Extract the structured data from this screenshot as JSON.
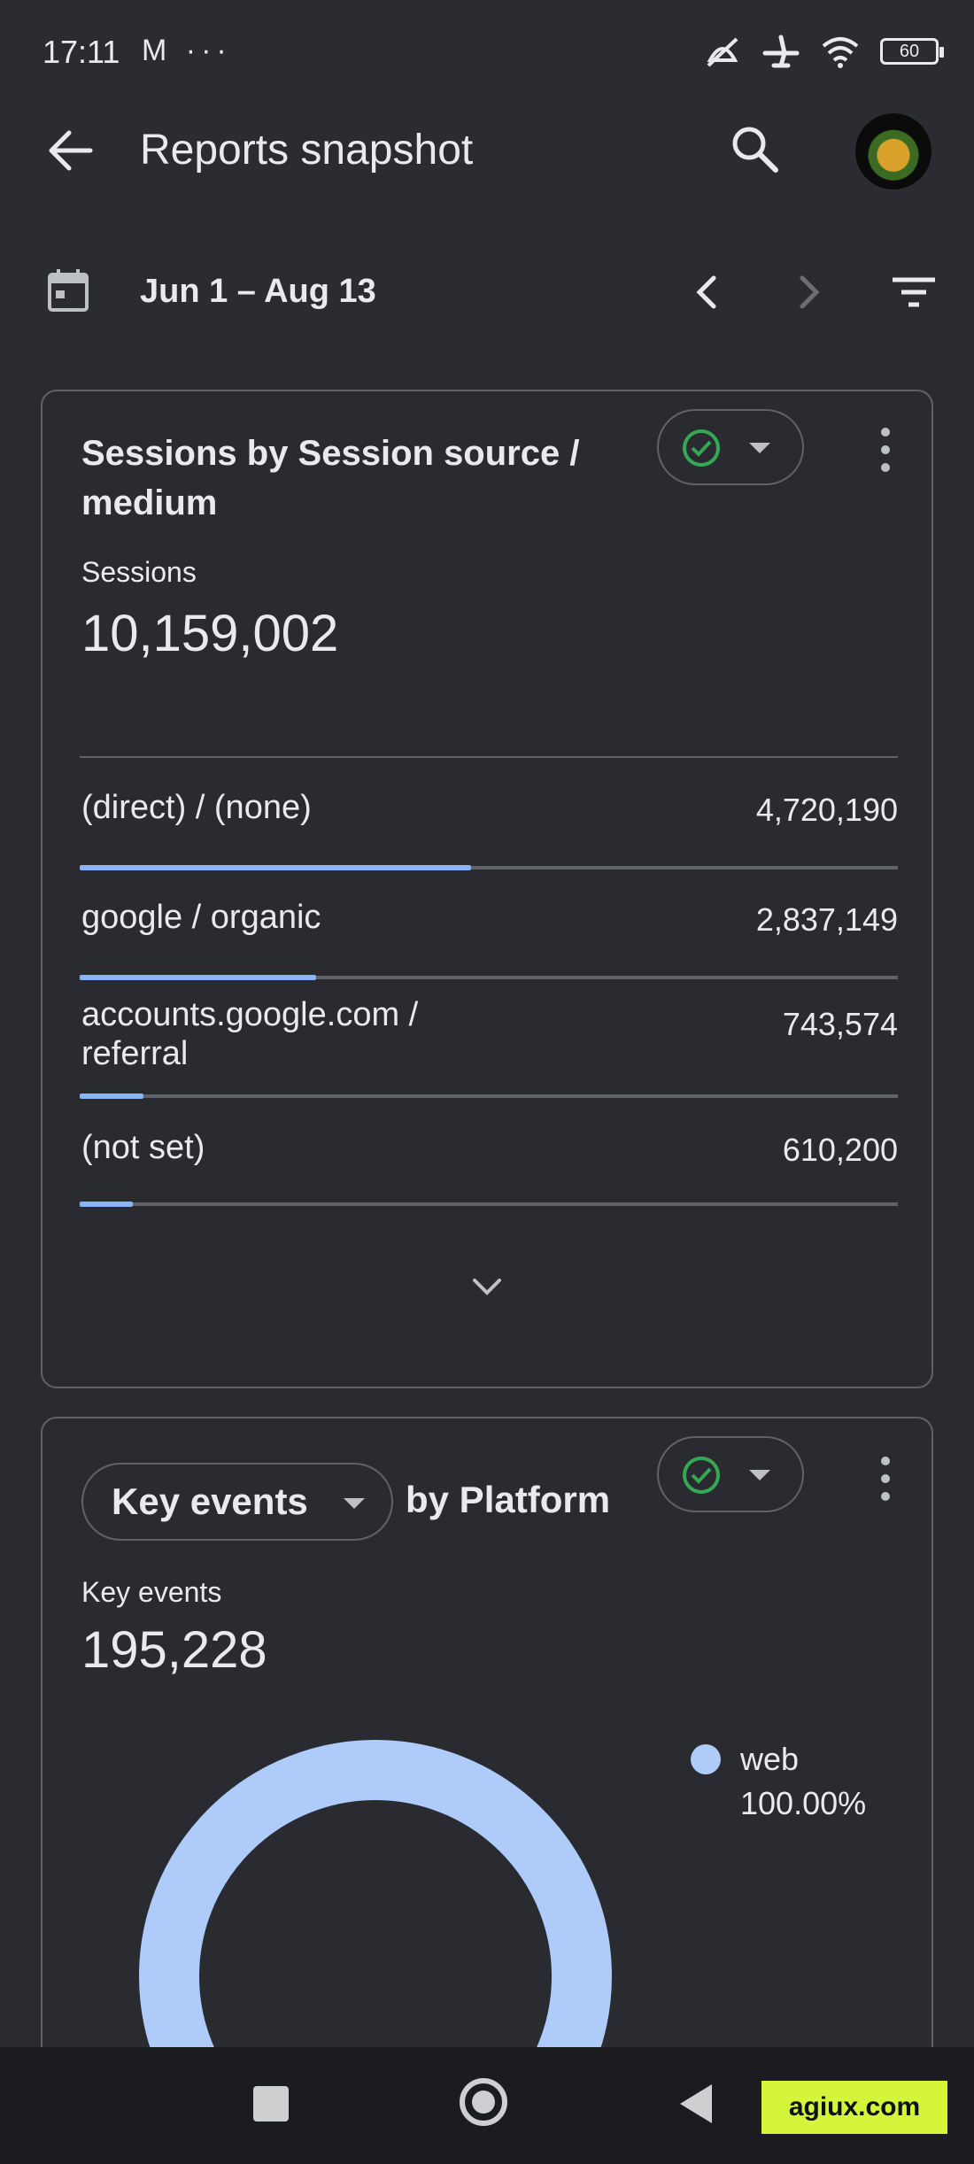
{
  "status_bar": {
    "time": "17:11",
    "left_icons": "M ···",
    "battery": "60"
  },
  "app_bar": {
    "title": "Reports snapshot"
  },
  "date_bar": {
    "range": "Jun 1 – Aug 13"
  },
  "card_sessions": {
    "title": "Sessions by Session source / medium",
    "metric_label": "Sessions",
    "metric_value": "10,159,002",
    "rows": [
      {
        "label": "(direct) / (none)",
        "value": "4,720,190",
        "share": 0.478
      },
      {
        "label": "google / organic",
        "value": "2,837,149",
        "share": 0.289
      },
      {
        "label": "accounts.google.com / referral",
        "value": "743,574",
        "share": 0.078
      },
      {
        "label": "(not set)",
        "value": "610,200",
        "share": 0.065
      }
    ]
  },
  "card_key_events": {
    "metric_dropdown": "Key events",
    "title_suffix": "by Platform",
    "metric_label": "Key events",
    "metric_value": "195,228",
    "legend": [
      {
        "name": "web",
        "percent": "100.00%",
        "color": "#aecbfa"
      }
    ]
  },
  "watermark": "agiux.com",
  "colors": {
    "accent_bar": "#8ab4f8",
    "check_green": "#1e8e3e",
    "donut": "#aecbfa"
  }
}
